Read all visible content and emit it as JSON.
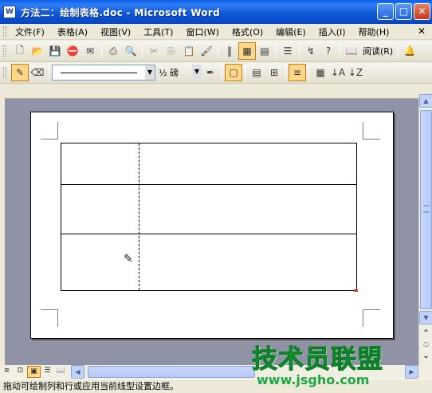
{
  "window": {
    "title": "方法二：绘制表格.doc - Microsoft Word",
    "app_icon": "W"
  },
  "menu": [
    "文件(F)",
    "表格(A)",
    "视图(V)",
    "工具(T)",
    "窗口(W)",
    "格式(O)",
    "编辑(E)",
    "插入(I)",
    "帮助(H)"
  ],
  "toolbar": {
    "read_label": "阅读(R)",
    "line_weight": "½ 磅",
    "icons": [
      "new-icon",
      "open-icon",
      "save-icon",
      "permission-icon",
      "email-icon",
      "print-icon",
      "print-preview-icon",
      "cut-icon",
      "copy-icon",
      "paste-icon",
      "format-painter-icon",
      "show-hide-icon",
      "tables-borders-icon",
      "insert-table-icon",
      "columns-icon",
      "drawing-icon",
      "help-icon",
      "research-icon"
    ]
  },
  "document": {
    "table_rows": 3,
    "table_cols": 2
  },
  "status": {
    "text": "拖动可绘制列和行或应用当前线型设置边框。"
  },
  "watermark": {
    "main": "技术员联盟",
    "url": "www.jsgho.com"
  }
}
